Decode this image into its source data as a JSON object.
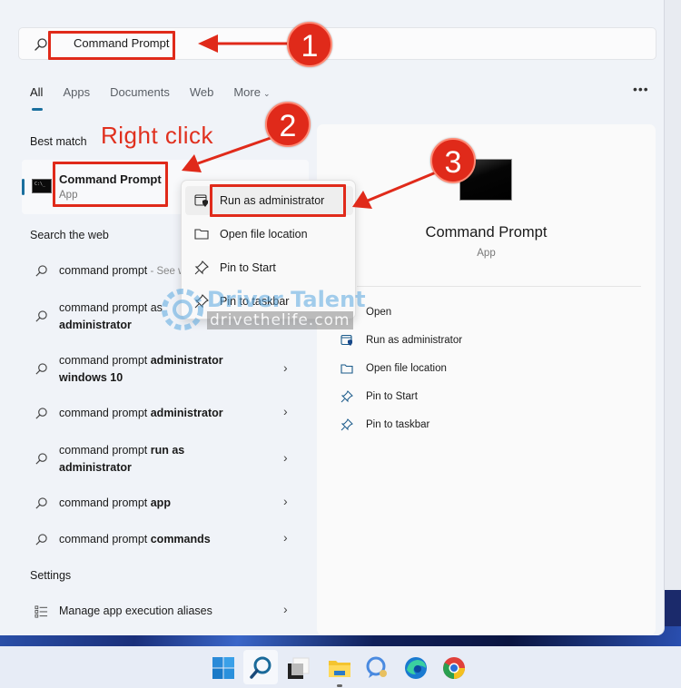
{
  "search": {
    "value": "Command Prompt",
    "placeholder": ""
  },
  "tabs": [
    {
      "label": "All",
      "active": true
    },
    {
      "label": "Apps",
      "active": false
    },
    {
      "label": "Documents",
      "active": false
    },
    {
      "label": "Web",
      "active": false
    },
    {
      "label": "More",
      "active": false
    }
  ],
  "more_options_icon": "ellipsis-icon",
  "best_match": {
    "section_label": "Best match",
    "title": "Command Prompt",
    "subtitle": "App",
    "icon": "cmd-icon"
  },
  "search_web": {
    "section_label": "Search the web",
    "results": [
      {
        "prefix": "command prompt",
        "bold": "",
        "line2": "",
        "suffix": " - See web results",
        "has_chevron": false
      },
      {
        "prefix": "command prompt as",
        "bold": "",
        "line2": "administrator",
        "suffix": "",
        "has_chevron": false
      },
      {
        "prefix": "command prompt ",
        "bold": "administrator",
        "line2": "windows 10",
        "suffix": "",
        "has_chevron": true
      },
      {
        "prefix": "command prompt ",
        "bold": "administrator",
        "line2": "",
        "suffix": "",
        "has_chevron": true
      },
      {
        "prefix": "command prompt ",
        "bold": "run as",
        "line2": "administrator",
        "suffix": "",
        "has_chevron": true
      },
      {
        "prefix": "command prompt ",
        "bold": "app",
        "line2": "",
        "suffix": "",
        "has_chevron": true
      },
      {
        "prefix": "command prompt ",
        "bold": "commands",
        "line2": "",
        "suffix": "",
        "has_chevron": true
      }
    ]
  },
  "settings": {
    "section_label": "Settings",
    "items": [
      {
        "label": "Manage app execution aliases",
        "icon": "list-settings-icon",
        "has_chevron": true
      }
    ]
  },
  "context_menu": {
    "items": [
      {
        "label": "Run as administrator",
        "icon": "shield-window-icon",
        "highlighted": true
      },
      {
        "label": "Open file location",
        "icon": "folder-icon",
        "highlighted": false
      },
      {
        "label": "Pin to Start",
        "icon": "pin-icon",
        "highlighted": false
      },
      {
        "label": "Pin to taskbar",
        "icon": "pin-icon",
        "highlighted": false
      }
    ]
  },
  "detail_pane": {
    "title": "Command Prompt",
    "subtitle": "App",
    "actions": [
      {
        "label": "Open",
        "icon": ""
      },
      {
        "label": "Run as administrator",
        "icon": "shield-window-icon"
      },
      {
        "label": "Open file location",
        "icon": "folder-icon"
      },
      {
        "label": "Pin to Start",
        "icon": "pin-icon"
      },
      {
        "label": "Pin to taskbar",
        "icon": "pin-icon"
      }
    ]
  },
  "annotations": {
    "step1": "1",
    "step2": "2",
    "step3": "3",
    "right_click_label": "Right click",
    "color": "#e02a1a"
  },
  "watermark": {
    "line1": "Driver Talent",
    "line2": "drivethelife.com"
  },
  "taskbar": {
    "items": [
      {
        "name": "start",
        "icon": "windows-logo-icon"
      },
      {
        "name": "search",
        "icon": "search-icon",
        "active": true
      },
      {
        "name": "task-view",
        "icon": "task-view-icon"
      },
      {
        "name": "file-explorer",
        "icon": "folder-icon",
        "running": true
      },
      {
        "name": "chat",
        "icon": "chat-icon"
      },
      {
        "name": "edge",
        "icon": "edge-icon"
      },
      {
        "name": "chrome",
        "icon": "chrome-icon"
      }
    ]
  },
  "colors": {
    "accent": "#1a6f9e",
    "annotation_red": "#e02a1a",
    "panel_bg": "#f0f3f8"
  }
}
